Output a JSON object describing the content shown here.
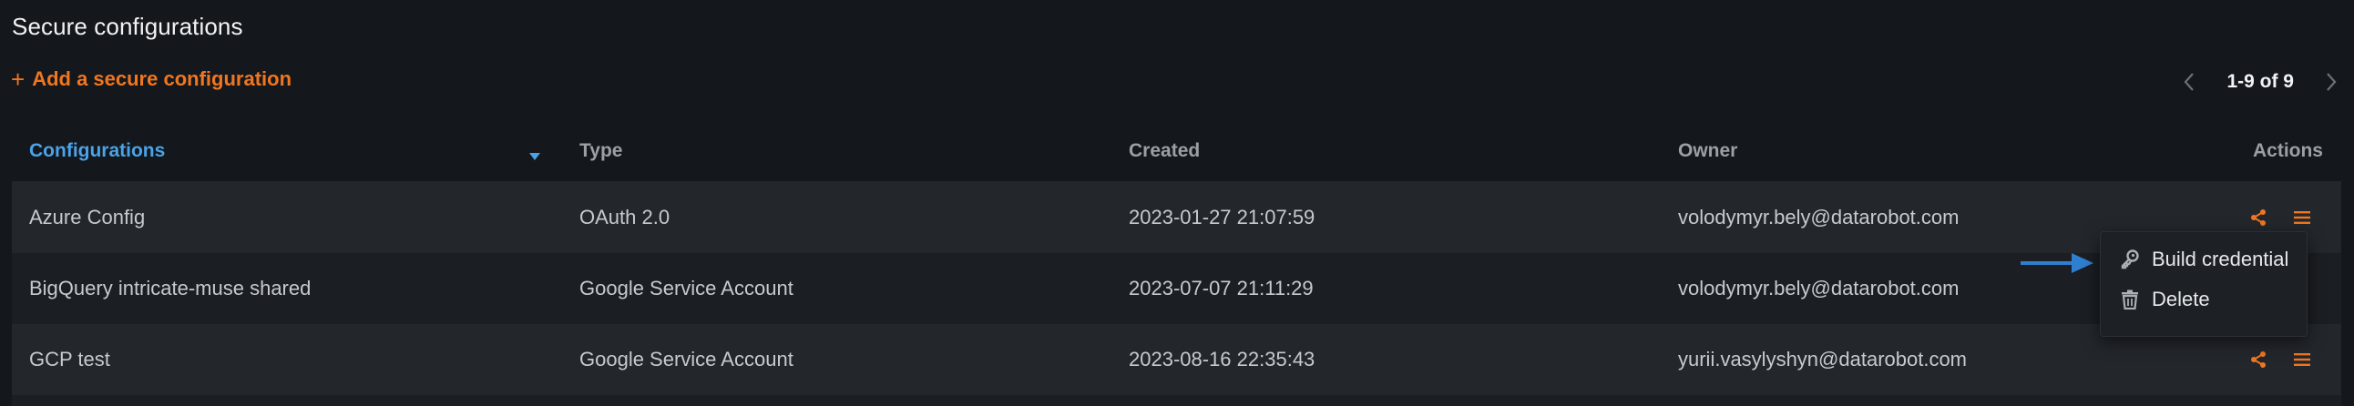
{
  "page": {
    "title": "Secure configurations"
  },
  "toolbar": {
    "add_label": "Add a secure configuration",
    "plus": "+"
  },
  "pagination": {
    "range": "1-9 of 9"
  },
  "table": {
    "headers": {
      "configurations": "Configurations",
      "type": "Type",
      "created": "Created",
      "owner": "Owner",
      "actions": "Actions"
    },
    "rows": [
      {
        "name": "Azure Config",
        "type": "OAuth 2.0",
        "created": "2023-01-27 21:07:59",
        "owner": "volodymyr.bely@datarobot.com"
      },
      {
        "name": "BigQuery intricate-muse shared",
        "type": "Google Service Account",
        "created": "2023-07-07 21:11:29",
        "owner": "volodymyr.bely@datarobot.com"
      },
      {
        "name": "GCP test",
        "type": "Google Service Account",
        "created": "2023-08-16 22:35:43",
        "owner": "yurii.vasylyshyn@datarobot.com"
      }
    ]
  },
  "menu": {
    "items": [
      {
        "label": "Build credential",
        "icon": "key-icon"
      },
      {
        "label": "Delete",
        "icon": "trash-icon"
      }
    ]
  },
  "colors": {
    "accent_orange": "#f07620",
    "accent_blue": "#4aa3e8",
    "annotation_arrow": "#2f7fd0",
    "background": "#14171b"
  }
}
